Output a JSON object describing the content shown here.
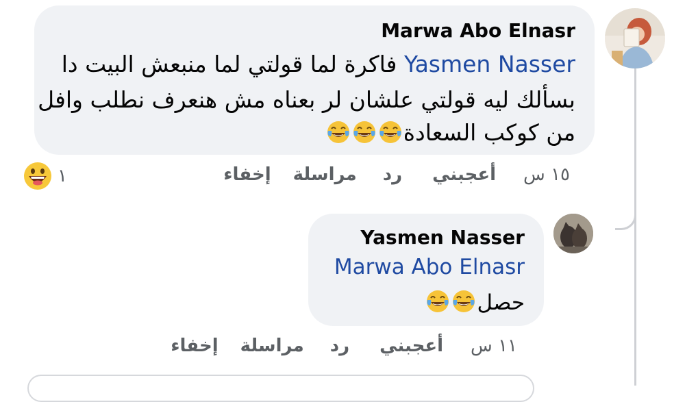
{
  "comment": {
    "author": "Marwa Abo Elnasr",
    "mention": "Yasmen Nasser",
    "line1": "فاكرة لما قولتي لما منبعش البيت دا",
    "line2": "بسألك ليه قولتي علشان لر بعناه مش هنعرف نطلب وافل",
    "line3": "من كوكب السعادة",
    "emoji_count": 3,
    "actions": {
      "time": "١٥ س",
      "like": "أعجبني",
      "reply": "رد",
      "message": "مراسلة",
      "hide": "إخفاء"
    },
    "reaction": {
      "count": "١",
      "icon": "grinning-face-icon"
    }
  },
  "reply": {
    "author": "Yasmen Nasser",
    "mention": "Marwa Abo Elnasr",
    "text": "حصل",
    "emoji_count": 2,
    "actions": {
      "time": "١١ س",
      "like": "أعجبني",
      "reply": "رد",
      "message": "مراسلة",
      "hide": "إخفاء"
    }
  },
  "colors": {
    "bubble": "#f0f2f5",
    "mention": "#1f4aa2",
    "meta": "#5c6064",
    "thread_line": "#ced0d4"
  },
  "icons": [
    "tears-of-joy-icon",
    "grinning-face-icon"
  ]
}
